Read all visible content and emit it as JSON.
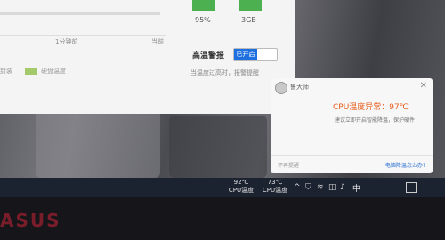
{
  "app": {
    "stats": [
      {
        "value": "95%"
      },
      {
        "value": "3GB"
      }
    ],
    "axis": {
      "left": "1分钟前",
      "right": "当前"
    },
    "legend": [
      {
        "label": "封装"
      },
      {
        "label": "硬盘温度"
      }
    ],
    "alert_section": {
      "title": "高温警报",
      "toggle_label": "已开启",
      "description": "当温度过高时，报警提醒"
    }
  },
  "notification": {
    "app_name": "鲁大师",
    "title": "CPU温度异常：97℃",
    "message": "建议立即开启智能降温，保护硬件",
    "ignore_label": "不再提醒",
    "action_label": "电脑降温怎么办?",
    "accent_color": "#f26a2a"
  },
  "taskbar": {
    "temps": [
      {
        "value": "92℃",
        "label": "CPU温度"
      },
      {
        "value": "73℃",
        "label": "CPU温度"
      }
    ],
    "ime": "中",
    "tray_icons": [
      "chevron-up-icon",
      "shield-icon",
      "wifi-icon",
      "network-icon",
      "volume-icon"
    ]
  },
  "bezel": {
    "brand": "ASUS"
  }
}
